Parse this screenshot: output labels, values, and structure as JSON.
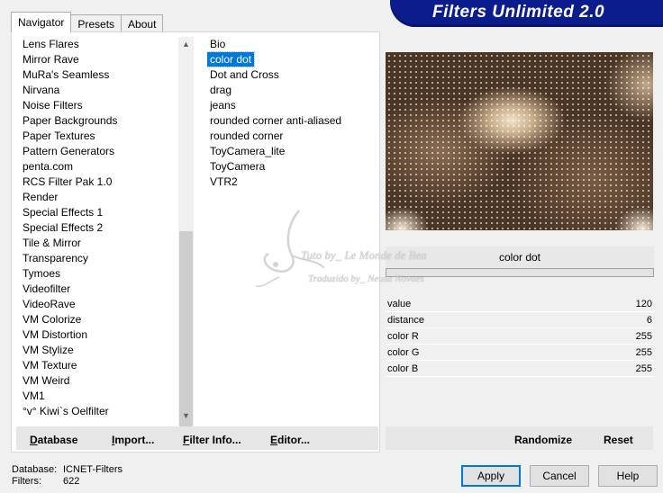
{
  "window_title": "Filters Unlimited 2.0",
  "tabs": [
    {
      "label": "Navigator",
      "active": true
    },
    {
      "label": "Presets",
      "active": false
    },
    {
      "label": "About",
      "active": false
    }
  ],
  "categories": [
    "Lens Flares",
    "Mirror Rave",
    "MuRa's Seamless",
    "Nirvana",
    "Noise Filters",
    "Paper Backgrounds",
    "Paper Textures",
    "Pattern Generators",
    "penta.com",
    "RCS Filter Pak 1.0",
    "Render",
    "Special Effects 1",
    "Special Effects 2",
    "Tile & Mirror",
    "Transparency",
    "Tymoes",
    "Videofilter",
    "VideoRave",
    "VM Colorize",
    "VM Distortion",
    "VM Stylize",
    "VM Texture",
    "VM Weird",
    "VM1",
    "°v° Kiwi`s Oelfilter"
  ],
  "filters": [
    {
      "label": "Bio",
      "selected": false
    },
    {
      "label": "color dot",
      "selected": true
    },
    {
      "label": "Dot and Cross",
      "selected": false
    },
    {
      "label": "drag",
      "selected": false
    },
    {
      "label": "jeans",
      "selected": false
    },
    {
      "label": "rounded corner anti-aliased",
      "selected": false
    },
    {
      "label": "rounded corner",
      "selected": false
    },
    {
      "label": "ToyCamera_lite",
      "selected": false
    },
    {
      "label": "ToyCamera",
      "selected": false
    },
    {
      "label": "VTR2",
      "selected": false
    }
  ],
  "preview": {
    "filter_name": "color dot"
  },
  "params": [
    {
      "name": "value",
      "value": "120"
    },
    {
      "name": "distance",
      "value": "6"
    },
    {
      "name": "color R",
      "value": "255"
    },
    {
      "name": "color G",
      "value": "255"
    },
    {
      "name": "color B",
      "value": "255"
    }
  ],
  "watermark": {
    "line1": "Tuto by_ Le Monde de Bea",
    "line2": "Traduzido by_ Neusa Novaes"
  },
  "toolbar": {
    "database": {
      "first": "D",
      "rest": "atabase"
    },
    "import": {
      "first": "I",
      "rest": "mport..."
    },
    "filter_info": {
      "first": "F",
      "rest": "ilter Info..."
    },
    "editor": {
      "first": "E",
      "rest": "ditor..."
    },
    "randomize": "Randomize",
    "reset": "Reset"
  },
  "status": {
    "database_label": "Database:",
    "database_value": "ICNET-Filters",
    "filters_label": "Filters:",
    "filters_value": "622"
  },
  "buttons": {
    "apply": "Apply",
    "cancel": "Cancel",
    "help": "Help"
  },
  "colors": {
    "banner": "#0b1d8c",
    "selection": "#0078d7"
  },
  "icons": {
    "scroll_up": "▲",
    "scroll_down": "▼"
  }
}
